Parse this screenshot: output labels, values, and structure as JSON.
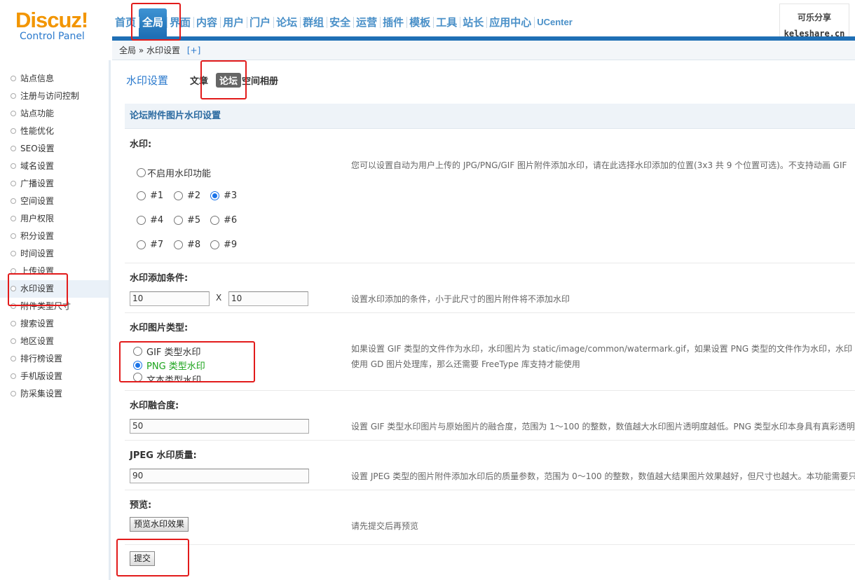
{
  "logo": {
    "brand": "Discuz!",
    "subtitle": "Control Panel"
  },
  "topnav": {
    "items": [
      "首页",
      "全局",
      "界面",
      "内容",
      "用户",
      "门户",
      "论坛",
      "群组",
      "安全",
      "运营",
      "插件",
      "模板",
      "工具",
      "站长",
      "应用中心",
      "UCenter"
    ],
    "active": "全局"
  },
  "watermark": {
    "line1": "可乐分享",
    "line2": "keleshare.cn"
  },
  "breadcrumb": {
    "root": "全局",
    "sep": "»",
    "current": "水印设置",
    "add": "[+]"
  },
  "sidebar": {
    "items": [
      "站点信息",
      "注册与访问控制",
      "站点功能",
      "性能优化",
      "SEO设置",
      "域名设置",
      "广播设置",
      "空间设置",
      "用户权限",
      "积分设置",
      "时间设置",
      "上传设置",
      "水印设置",
      "附件类型尺寸",
      "搜索设置",
      "地区设置",
      "排行榜设置",
      "手机版设置",
      "防采集设置"
    ],
    "active_index": 12
  },
  "main": {
    "title": "水印设置",
    "tabs": [
      "文章",
      "论坛",
      "空间相册"
    ],
    "active_tab": "论坛",
    "section_title": "论坛附件图片水印设置",
    "watermark_pos": {
      "label": "水印:",
      "disable_label": "不启用水印功能",
      "positions": [
        "#1",
        "#2",
        "#3",
        "#4",
        "#5",
        "#6",
        "#7",
        "#8",
        "#9"
      ],
      "selected": "#3",
      "desc": "您可以设置自动为用户上传的 JPG/PNG/GIF 图片附件添加水印，请在此选择水印添加的位置(3x3 共 9 个位置可选)。不支持动画 GIF"
    },
    "condition": {
      "label": "水印添加条件:",
      "width": "10",
      "x": "X",
      "height": "10",
      "desc": "设置水印添加的条件，小于此尺寸的图片附件将不添加水印"
    },
    "type": {
      "label": "水印图片类型:",
      "options": [
        "GIF 类型水印",
        "PNG 类型水印",
        "文本类型水印"
      ],
      "selected": "PNG 类型水印",
      "desc1": "如果设置 GIF 类型的文件作为水印，水印图片为 static/image/common/watermark.gif，如果设置 PNG 类型的文件作为水印，水印",
      "desc2": "使用 GD 图片处理库，那么还需要 FreeType 库支持才能使用"
    },
    "blend": {
      "label": "水印融合度:",
      "value": "50",
      "desc": "设置 GIF 类型水印图片与原始图片的融合度，范围为 1～100 的整数，数值越大水印图片透明度越低。PNG 类型水印本身具有真彩透明"
    },
    "jpeg": {
      "label": "JPEG 水印质量:",
      "value": "90",
      "desc": "设置 JPEG 类型的图片附件添加水印后的质量参数，范围为 0～100 的整数，数值越大结果图片效果越好，但尺寸也越大。本功能需要只"
    },
    "preview": {
      "label": "预览:",
      "button": "预览水印效果",
      "desc": "请先提交后再预览"
    },
    "submit": "提交"
  }
}
